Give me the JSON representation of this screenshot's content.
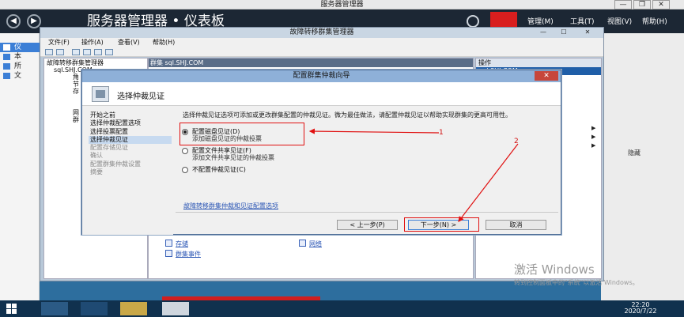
{
  "server_manager": {
    "window_title": "服务器管理器",
    "breadcrumb": "服务器管理器 • 仪表板",
    "menu": [
      "管理(M)",
      "工具(T)",
      "视图(V)",
      "帮助(H)"
    ],
    "sidebar": [
      "仪",
      "本",
      "所",
      "文"
    ],
    "hide_label": "隐藏"
  },
  "fcm": {
    "title": "故障转移群集管理器",
    "menu": [
      "文件(F)",
      "操作(A)",
      "查看(V)",
      "帮助(H)"
    ],
    "tree": [
      "故障转移群集管理器",
      "sql.SHJ.COM",
      "角",
      "节",
      "存",
      "网",
      "群"
    ],
    "center_header": "群集 sql.SHJ.COM",
    "center_links": [
      "存储",
      "网络",
      "群集事件"
    ],
    "actions_header": "操作",
    "actions_sub": "sql.SHJ.COM"
  },
  "wizard": {
    "title": "配置群集仲裁向导",
    "page_title": "选择仲裁见证",
    "close": "✕",
    "steps": [
      "开始之前",
      "选择仲裁配置选项",
      "选择投票配置",
      "选择仲裁见证",
      "配置存储见证",
      "确认",
      "配置群集仲裁设置",
      "摘要"
    ],
    "description": "选择仲裁见证选项可添加或更改群集配置的仲裁见证。微为最佳做法，请配置仲裁见证以帮助实现群集的更高可用性。",
    "options": [
      {
        "label": "配置磁盘见证(D)",
        "sub": "添加磁盘见证的仲裁投票",
        "selected": true
      },
      {
        "label": "配置文件共享见证(F)",
        "sub": "添加文件共享见证的仲裁投票",
        "selected": false
      },
      {
        "label": "不配置仲裁见证(C)",
        "sub": "",
        "selected": false
      }
    ],
    "more_link": "故障转移群集仲裁和见证配置选项",
    "buttons": {
      "prev": "< 上一步(P)",
      "next": "下一步(N) >",
      "cancel": "取消"
    }
  },
  "annotations": {
    "label1": "1",
    "label2": "2"
  },
  "watermark": {
    "line1": "激活 Windows",
    "line2": "转到控制面板中的\"系统\"以激活 Windows。"
  },
  "taskbar": {
    "time": "22:20",
    "date": "2020/7/22"
  },
  "colors": {
    "accent_red": "#e01010",
    "header_dark": "#1c2734",
    "selection_blue": "#3c7fd6"
  }
}
